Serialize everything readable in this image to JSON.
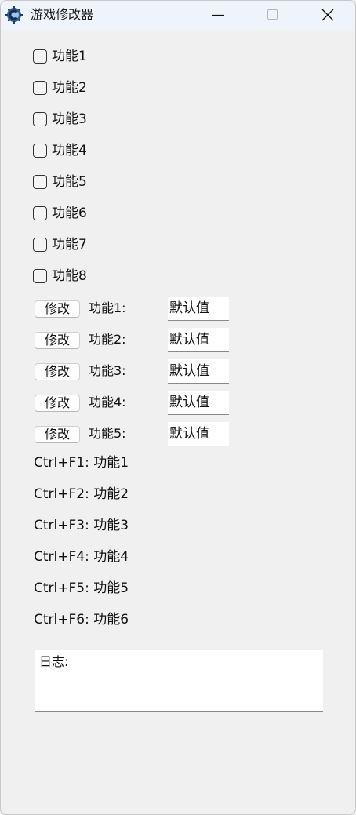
{
  "window": {
    "title": "游戏修改器"
  },
  "checkboxes": [
    {
      "label": "功能1",
      "checked": false
    },
    {
      "label": "功能2",
      "checked": false
    },
    {
      "label": "功能3",
      "checked": false
    },
    {
      "label": "功能4",
      "checked": false
    },
    {
      "label": "功能5",
      "checked": false
    },
    {
      "label": "功能6",
      "checked": false
    },
    {
      "label": "功能7",
      "checked": false
    },
    {
      "label": "功能8",
      "checked": false
    }
  ],
  "modifiers": [
    {
      "button": "修改",
      "label": "功能1:",
      "value": "默认值"
    },
    {
      "button": "修改",
      "label": "功能2:",
      "value": "默认值"
    },
    {
      "button": "修改",
      "label": "功能3:",
      "value": "默认值"
    },
    {
      "button": "修改",
      "label": "功能4:",
      "value": "默认值"
    },
    {
      "button": "修改",
      "label": "功能5:",
      "value": "默认值"
    }
  ],
  "hotkeys": [
    "Ctrl+F1: 功能1",
    "Ctrl+F2: 功能2",
    "Ctrl+F3: 功能3",
    "Ctrl+F4: 功能4",
    "Ctrl+F5: 功能5",
    "Ctrl+F6: 功能6"
  ],
  "log": {
    "label": "日志:"
  },
  "icons": {
    "app": "cheat-engine-icon",
    "minimize": "minimize-icon",
    "maximize": "maximize-icon",
    "close": "close-icon"
  }
}
